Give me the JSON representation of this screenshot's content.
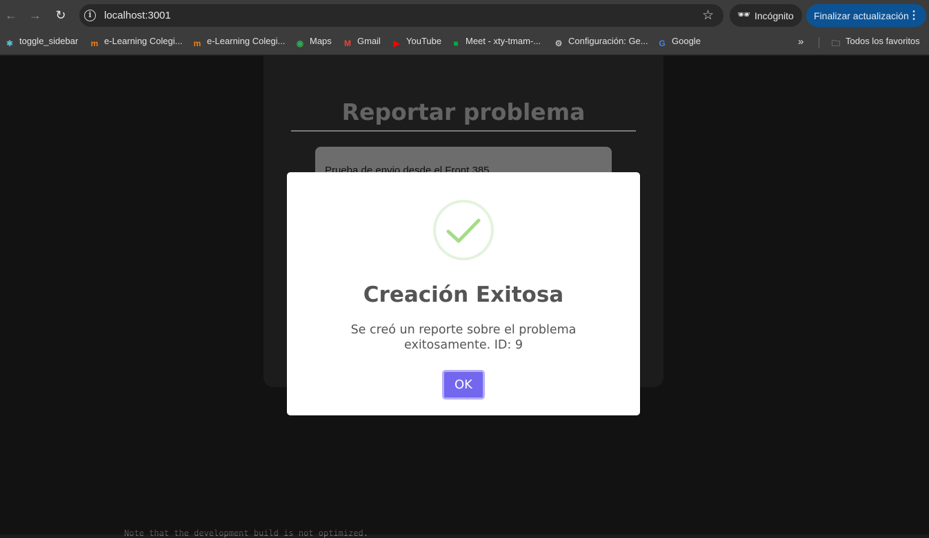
{
  "browser": {
    "url": "localhost:3001",
    "incognito_label": "Incógnito",
    "update_label": "Finalizar actualización",
    "bookmarks": [
      {
        "label": "toggle_sidebar",
        "icon": "react-icon"
      },
      {
        "label": "e-Learning Colegi...",
        "icon": "moodle-icon"
      },
      {
        "label": "e-Learning Colegi...",
        "icon": "moodle-icon"
      },
      {
        "label": "Maps",
        "icon": "maps-icon"
      },
      {
        "label": "Gmail",
        "icon": "gmail-icon"
      },
      {
        "label": "YouTube",
        "icon": "youtube-icon"
      },
      {
        "label": "Meet - xty-tmam-...",
        "icon": "meet-icon"
      },
      {
        "label": "Configuración: Ge...",
        "icon": "gear-icon"
      },
      {
        "label": "Google",
        "icon": "google-icon"
      }
    ],
    "all_bookmarks_label": "Todos los favoritos"
  },
  "page": {
    "title": "Reportar problema",
    "textarea_value": "Prueba de envio desde el Front 385",
    "footer_note": "Note that the development build is not optimized."
  },
  "modal": {
    "title": "Creación Exitosa",
    "message": "Se creó un reporte sobre el problema exitosamente. ID: 9",
    "ok_label": "OK",
    "icon": "success-check-icon"
  },
  "colors": {
    "accent_button": "#7367f0",
    "success_green": "#a5dc86",
    "update_button": "#0b5394"
  }
}
